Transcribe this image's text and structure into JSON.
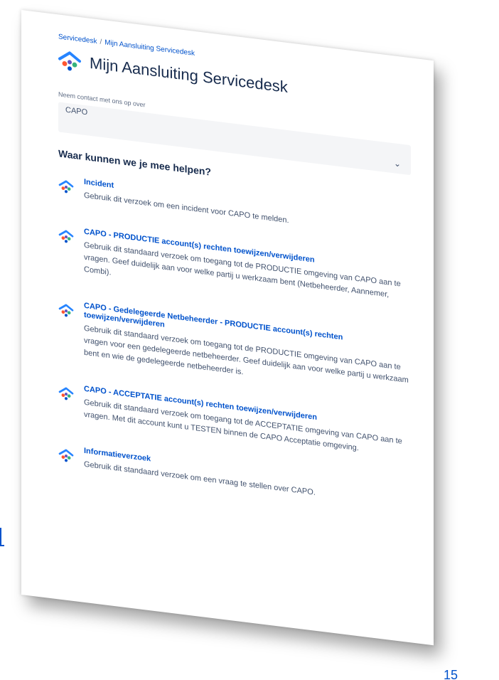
{
  "breadcrumb": {
    "home": "Servicedesk",
    "separator": "/",
    "current": "Mijn Aansluiting Servicedesk"
  },
  "header": {
    "title": "Mijn Aansluiting Servicedesk"
  },
  "contact": {
    "label": "Neem contact met ons op over",
    "selected": "CAPO",
    "chevron": "⌄"
  },
  "requests_heading": "Waar kunnen we je mee helpen?",
  "requests": [
    {
      "name": "Incident",
      "description": "Gebruik dit verzoek om een incident voor CAPO te melden."
    },
    {
      "name": "CAPO - PRODUCTIE account(s) rechten toewijzen/verwijderen",
      "description": "Gebruik dit standaard verzoek om toegang tot de PRODUCTIE omgeving van CAPO aan te vragen. Geef duidelijk aan voor welke partij u werkzaam bent (Netbeheerder, Aannemer, Combi)."
    },
    {
      "name": "CAPO - Gedelegeerde Netbeheerder - PRODUCTIE account(s) rechten toewijzen/verwijderen",
      "description": "Gebruik dit standaard verzoek om toegang tot de PRODUCTIE omgeving van CAPO aan te vragen voor een gedelegeerde netbeheerder. Geef duidelijk aan voor welke partij u werkzaam bent en wie de gedelegeerde netbeheerder is."
    },
    {
      "name": "CAPO - ACCEPTATIE account(s) rechten toewijzen/verwijderen",
      "description": "Gebruik dit standaard verzoek om toegang tot de ACCEPTATIE omgeving van CAPO aan te vragen. Met dit account kunt u TESTEN binnen de CAPO Acceptatie omgeving."
    },
    {
      "name": "Informatieverzoek",
      "description": "Gebruik dit standaard verzoek om een vraag te stellen over CAPO."
    }
  ],
  "page_number": "15",
  "colors": {
    "link": "#0052cc",
    "text": "#172b4d",
    "muted": "#42526e",
    "select_bg": "#f4f5f7"
  },
  "icons": {
    "logo": "servicedesk-logo-icon",
    "request": "request-type-icon"
  }
}
